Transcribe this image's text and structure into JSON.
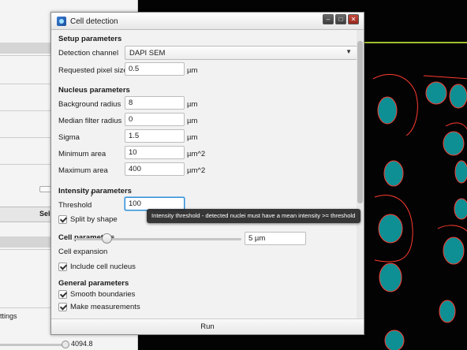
{
  "background": {
    "selected_header": "Sele",
    "settings_label": "ttings",
    "slider_value": "4094.8"
  },
  "dialog": {
    "title": "Cell detection",
    "setup": {
      "heading": "Setup parameters",
      "channel_label": "Detection channel",
      "channel_value": "DAPI SEM",
      "pixel_label": "Requested pixel size",
      "pixel_value": "0.5",
      "pixel_unit": "µm"
    },
    "nucleus": {
      "heading": "Nucleus parameters",
      "bg_radius_label": "Background radius",
      "bg_radius_value": "8",
      "bg_radius_unit": "µm",
      "median_label": "Median filter radius",
      "median_value": "0",
      "median_unit": "µm",
      "sigma_label": "Sigma",
      "sigma_value": "1.5",
      "sigma_unit": "µm",
      "min_area_label": "Minimum area",
      "min_area_value": "10",
      "min_area_unit": "µm^2",
      "max_area_label": "Maximum area",
      "max_area_value": "400",
      "max_area_unit": "µm^2"
    },
    "intensity": {
      "heading": "Intensity parameters",
      "threshold_label": "Threshold",
      "threshold_value": "100",
      "split_label": "Split by shape",
      "split_checked": true,
      "tooltip": "Intensity threshold - detected nuclei must have a mean intensity >= threshold"
    },
    "cell": {
      "heading": "Cell parameters",
      "expansion_label": "Cell expansion",
      "expansion_value": "5 µm",
      "expansion_fraction": 0.2,
      "include_label": "Include cell nucleus",
      "include_checked": true
    },
    "general": {
      "heading": "General parameters",
      "smooth_label": "Smooth boundaries",
      "smooth_checked": true,
      "measure_label": "Make measurements",
      "measure_checked": true
    },
    "run_label": "Run"
  },
  "colors": {
    "nucleus_fill": "#0e8f93",
    "outline": "#ff3b30",
    "viewer_bg": "#030303",
    "annotation_line": "#d4ff3c"
  },
  "icons": {
    "app": "qupath-app-icon",
    "dropdown": "chevron-down-icon",
    "minimize": "minimize-icon",
    "maximize": "maximize-icon",
    "close": "close-icon"
  }
}
